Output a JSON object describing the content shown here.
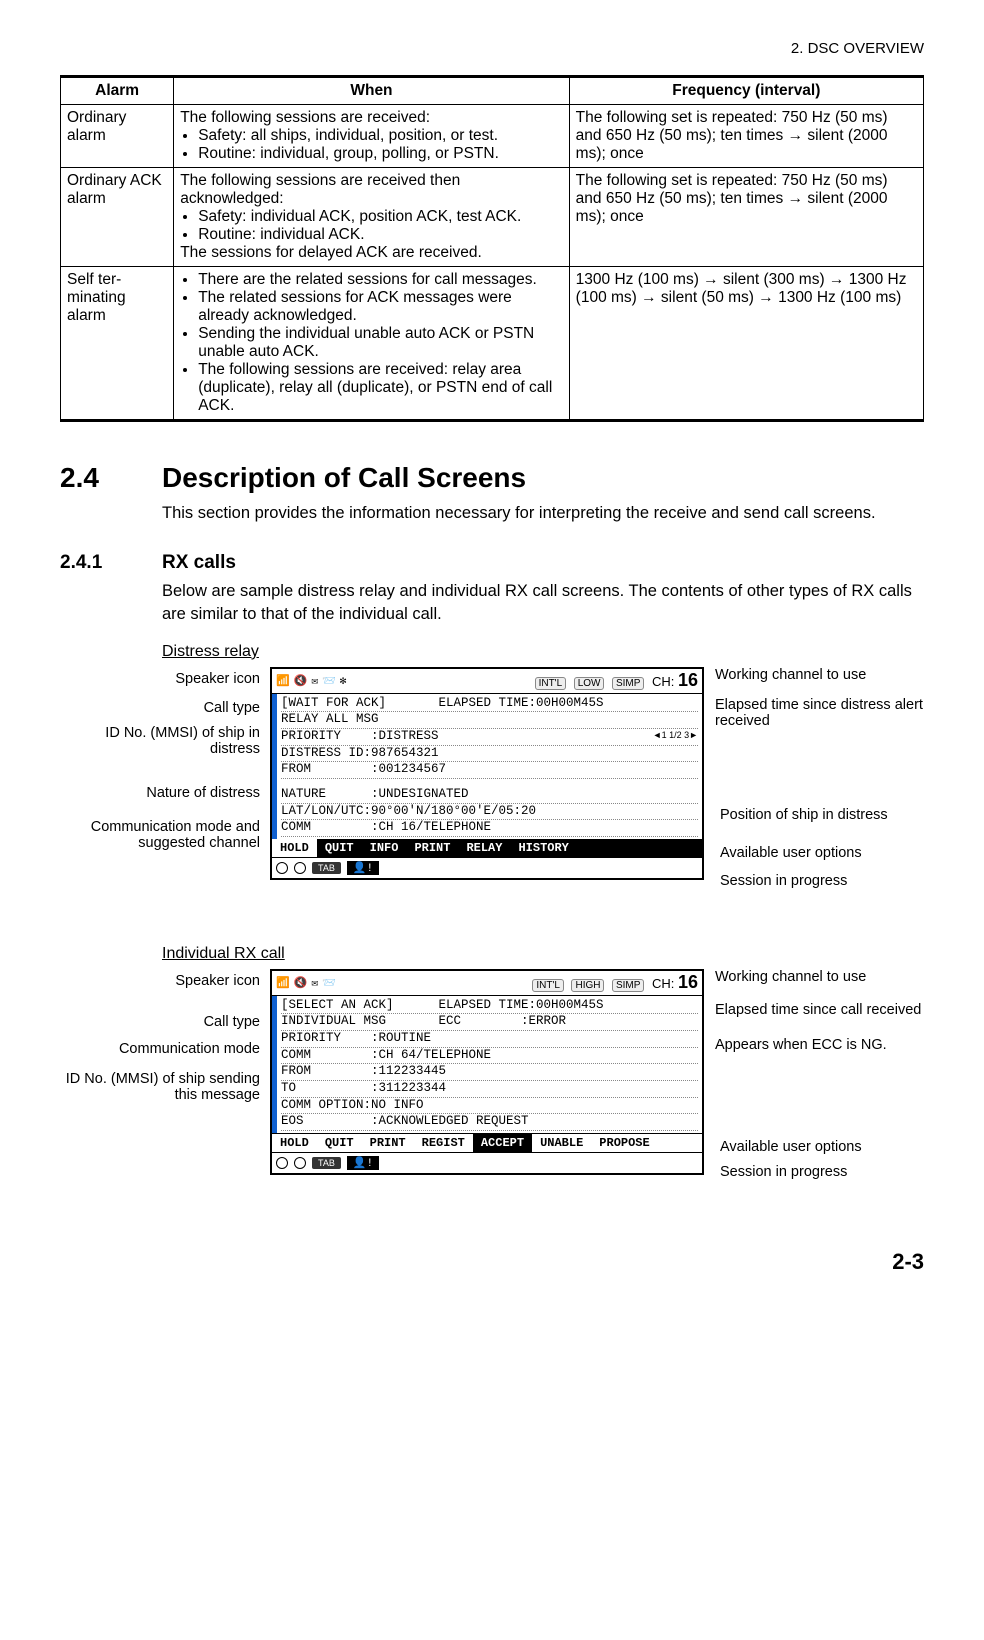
{
  "header": {
    "chapter": "2.  DSC OVERVIEW"
  },
  "table": {
    "headers": [
      "Alarm",
      "When",
      "Frequency (interval)"
    ],
    "rows": [
      {
        "alarm": "Ordinary alarm",
        "when_intro": "The following sessions are received:",
        "when_bullets": [
          "Safety: all ships, individual, position, or test.",
          "Routine: individual, group, polling, or PSTN."
        ],
        "when_outro": "",
        "freq": "The following set is repeated: 750 Hz (50 ms) and 650 Hz (50 ms); ten times → silent (2000 ms); once"
      },
      {
        "alarm": "Ordinary ACK alarm",
        "when_intro": "The following sessions are received then acknowledged:",
        "when_bullets": [
          "Safety: individual ACK, position ACK, test ACK.",
          "Routine: individual ACK."
        ],
        "when_outro": "The sessions for delayed ACK are received.",
        "freq": "The following set is repeated: 750 Hz (50 ms) and 650 Hz (50 ms); ten times → silent (2000 ms); once"
      },
      {
        "alarm": "Self ter-minating alarm",
        "when_intro": "",
        "when_bullets": [
          "There are the related sessions for call messages.",
          "The related sessions for ACK messages were already acknowledged.",
          "Sending the individual unable auto ACK or PSTN unable auto ACK.",
          "The following sessions are received: relay area (duplicate), relay all (duplicate), or PSTN end of call ACK."
        ],
        "when_outro": "",
        "freq": "1300 Hz (100 ms) → silent (300 ms) → 1300 Hz (100 ms) → silent (50 ms) → 1300 Hz (100 ms)"
      }
    ]
  },
  "sec24": {
    "num": "2.4",
    "title": "Description of Call Screens",
    "intro": "This section provides the information necessary for interpreting the receive and send call screens."
  },
  "sec241": {
    "num": "2.4.1",
    "title": "RX calls",
    "intro": "Below are sample distress relay and individual RX call screens. The contents of other types of RX calls are similar to that of the individual call."
  },
  "fig1": {
    "caption": "Distress relay",
    "badges": [
      "INT'L",
      "LOW",
      "SIMP"
    ],
    "ch_label": "CH:",
    "ch": "16",
    "lines": [
      "[WAIT FOR ACK]       ELAPSED TIME:00H00M45S",
      "RELAY ALL MSG",
      "PRIORITY    :DISTRESS",
      "DISTRESS ID:987654321",
      "FROM        :001234567",
      "",
      "NATURE      :UNDESIGNATED",
      "LAT/LON/UTC:90°00'N/180°00'E/05:20",
      "COMM        :CH 16/TELEPHONE"
    ],
    "page": "◄1 1/2 3►",
    "options": [
      "HOLD",
      "QUIT",
      "INFO",
      "PRINT",
      "RELAY",
      "HISTORY"
    ],
    "options_sel": 0,
    "annot_left": {
      "speaker": "Speaker icon",
      "calltype": "Call type",
      "id": "ID No. (MMSI) of ship in distress",
      "nature": "Nature of distress",
      "comm": "Communication mode and suggested channel"
    },
    "annot_right": {
      "workch": "Working channel to use",
      "elapsed": "Elapsed time since distress alert received",
      "pos": "Position of ship in distress",
      "opts": "Available user options",
      "sess": "Session in progress"
    }
  },
  "fig2": {
    "caption": "Individual RX call",
    "badges": [
      "INT'L",
      "HIGH",
      "SIMP"
    ],
    "ch_label": "CH:",
    "ch": "16",
    "lines": [
      "[SELECT AN ACK]      ELAPSED TIME:00H00M45S",
      "INDIVIDUAL MSG       ECC        :ERROR",
      "PRIORITY    :ROUTINE",
      "COMM        :CH 64/TELEPHONE",
      "FROM        :112233445",
      "TO          :311223344",
      "COMM OPTION:NO INFO",
      "EOS         :ACKNOWLEDGED REQUEST"
    ],
    "options": [
      "HOLD",
      "QUIT",
      "PRINT",
      "REGIST",
      "ACCEPT",
      "UNABLE",
      "PROPOSE"
    ],
    "options_sel": 4,
    "annot_left": {
      "speaker": "Speaker icon",
      "calltype": "Call type",
      "comm": "Communication mode",
      "id": "ID No. (MMSI) of ship sending this message"
    },
    "annot_right": {
      "workch": "Working channel to use",
      "elapsed": "Elapsed time since call received",
      "ecc": "Appears when ECC is NG.",
      "opts": "Available user options",
      "sess": "Session in progress"
    }
  },
  "page_num": "2-3"
}
